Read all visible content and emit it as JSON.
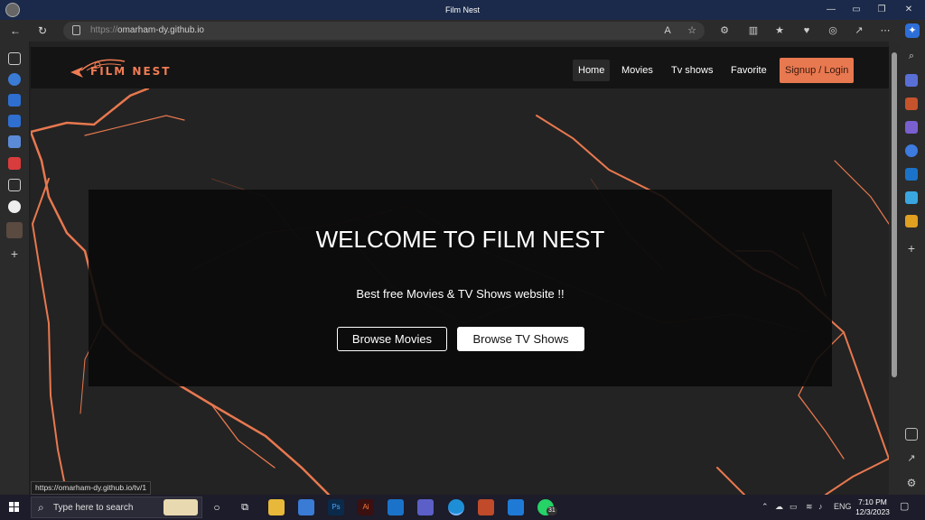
{
  "window": {
    "title": "Film Nest"
  },
  "browser": {
    "url_scheme": "https://",
    "url_host": "omarham-dy.github.io",
    "status_link": "https://omarham-dy.github.io/tv/1"
  },
  "site": {
    "logo_text": "FILM NEST",
    "nav": {
      "home": "Home",
      "movies": "Movies",
      "tv": "Tv shows",
      "favorite": "Favorite",
      "signup": "Signup / Login"
    },
    "hero": {
      "title": "WELCOME TO FILM NEST",
      "subtitle": "Best free Movies & TV Shows website !!",
      "browse_movies": "Browse Movies",
      "browse_tv": "Browse TV Shows"
    },
    "accent_color": "#e8784f"
  },
  "taskbar": {
    "search_placeholder": "Type here to search",
    "language": "ENG",
    "time": "7:10 PM",
    "date": "12/3/2023",
    "whatsapp_badge": "31"
  }
}
